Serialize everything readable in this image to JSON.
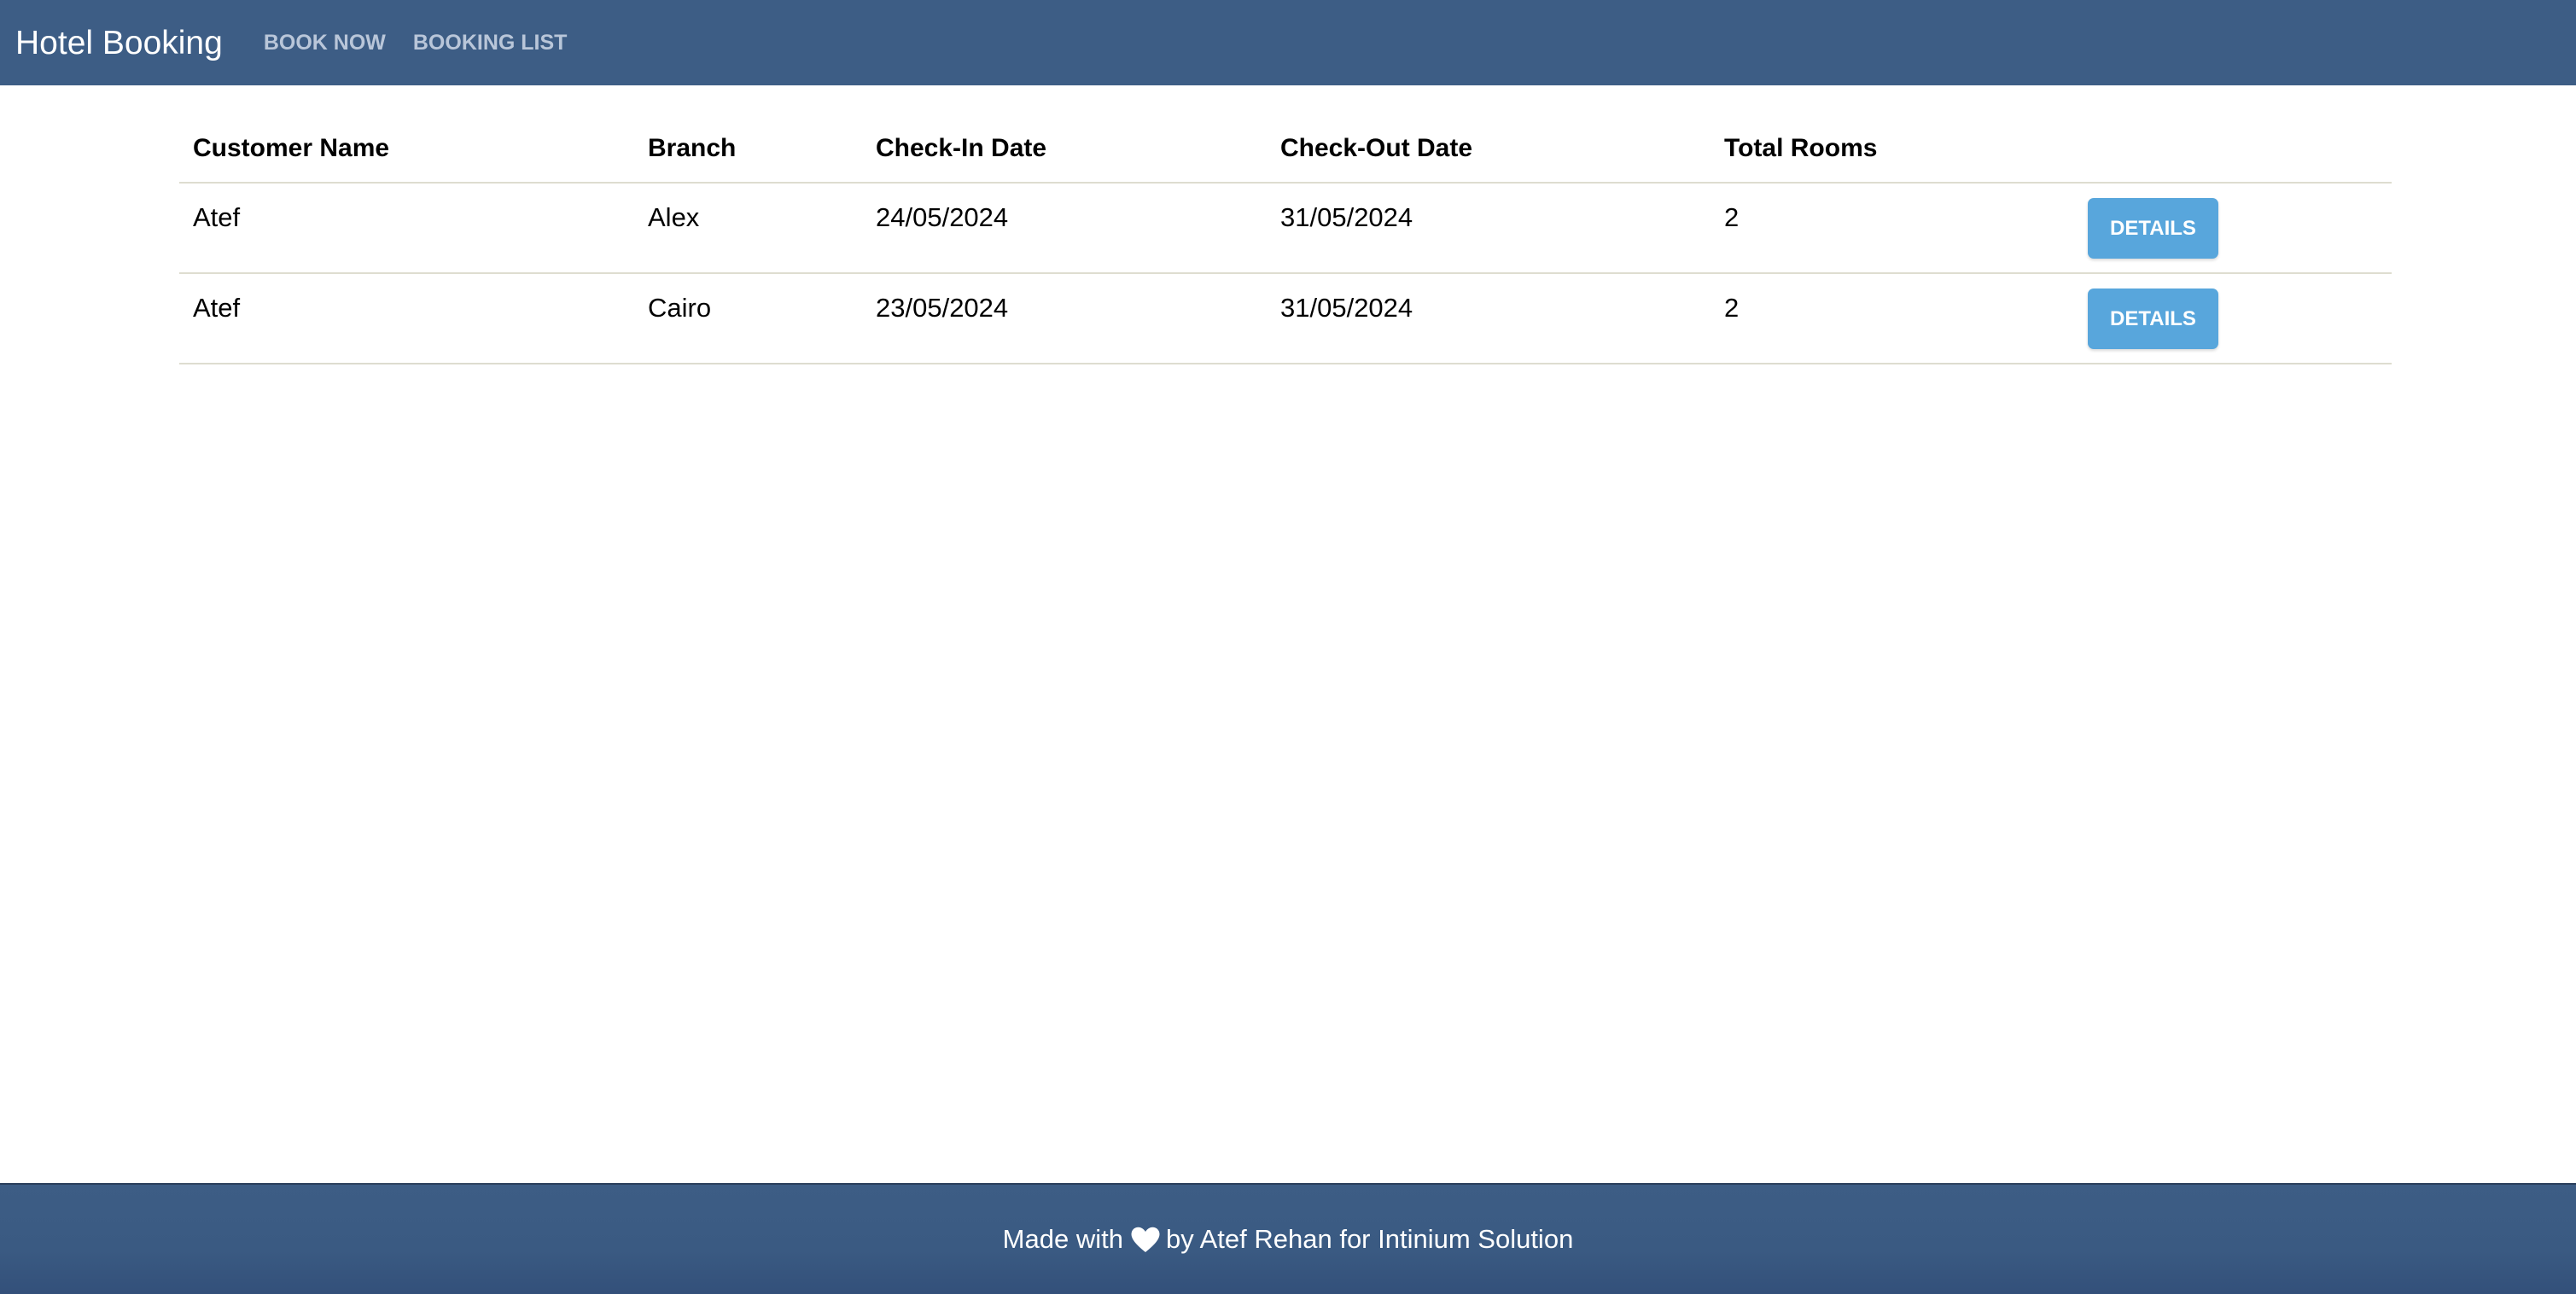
{
  "navbar": {
    "brand": "Hotel Booking",
    "links": [
      {
        "label": "BOOK NOW"
      },
      {
        "label": "BOOKING LIST"
      }
    ]
  },
  "table": {
    "headers": [
      "Customer Name",
      "Branch",
      "Check-In Date",
      "Check-Out Date",
      "Total Rooms",
      ""
    ],
    "rows": [
      {
        "customer": "Atef",
        "branch": "Alex",
        "check_in": "24/05/2024",
        "check_out": "31/05/2024",
        "rooms": "2",
        "action": "DETAILS"
      },
      {
        "customer": "Atef",
        "branch": "Cairo",
        "check_in": "23/05/2024",
        "check_out": "31/05/2024",
        "rooms": "2",
        "action": "DETAILS"
      }
    ]
  },
  "footer": {
    "text_before": "Made with",
    "icon": "heart-icon",
    "text_after": "by Atef Rehan for Intinium Solution"
  },
  "colors": {
    "navbar": "#3d5d85",
    "button": "#58a6dc",
    "nav_link": "#b9c6d9",
    "row_divider": "#deddd0"
  }
}
